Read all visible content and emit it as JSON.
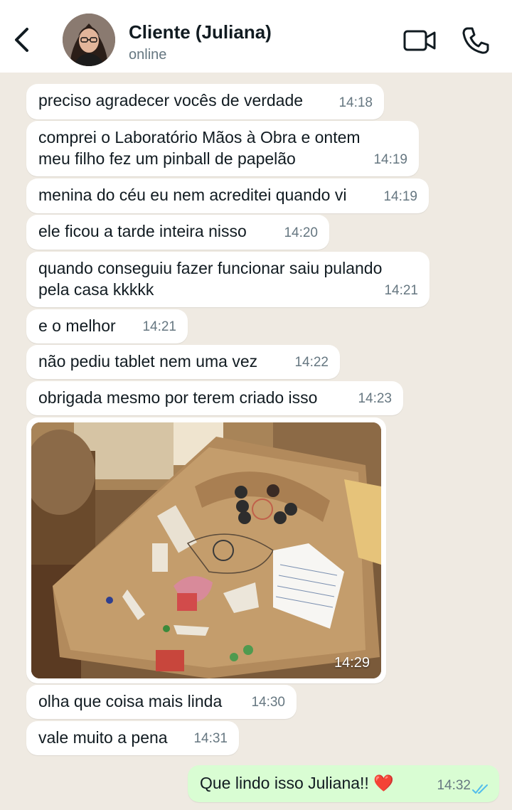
{
  "header": {
    "contact_name": "Cliente (Juliana)",
    "status": "online",
    "back_icon": "chevron-left-icon",
    "video_icon": "video-camera-icon",
    "call_icon": "phone-icon"
  },
  "colors": {
    "incoming_bubble": "#ffffff",
    "outgoing_bubble": "#d9fdd3",
    "chat_background": "#efeae2",
    "read_ticks": "#53bdeb"
  },
  "messages": [
    {
      "text": "preciso agradecer vocês de verdade",
      "time": "14:18"
    },
    {
      "text": "comprei o Laboratório Mãos à Obra e ontem\nmeu filho fez um pinball de papelão",
      "time": "14:19"
    },
    {
      "text": "menina do céu eu nem acreditei quando vi",
      "time": "14:19"
    },
    {
      "text": "ele ficou a tarde inteira nisso",
      "time": "14:20"
    },
    {
      "text": "quando conseguiu fazer funcionar saiu pulando\npela casa kkkkk",
      "time": "14:21"
    },
    {
      "text": "e o melhor",
      "time": "14:21"
    },
    {
      "text": "não pediu tablet nem uma vez",
      "time": "14:22"
    },
    {
      "text": "obrigada mesmo por terem criado isso",
      "time": "14:23"
    },
    {
      "text": "olha que coisa mais linda",
      "time": "14:30"
    },
    {
      "text": "vale muito a pena",
      "time": "14:31"
    }
  ],
  "photo_message": {
    "time": "14:29"
  },
  "outgoing": {
    "text": "Que lindo isso Juliana!! ❤️",
    "time": "14:32",
    "status": "read"
  }
}
